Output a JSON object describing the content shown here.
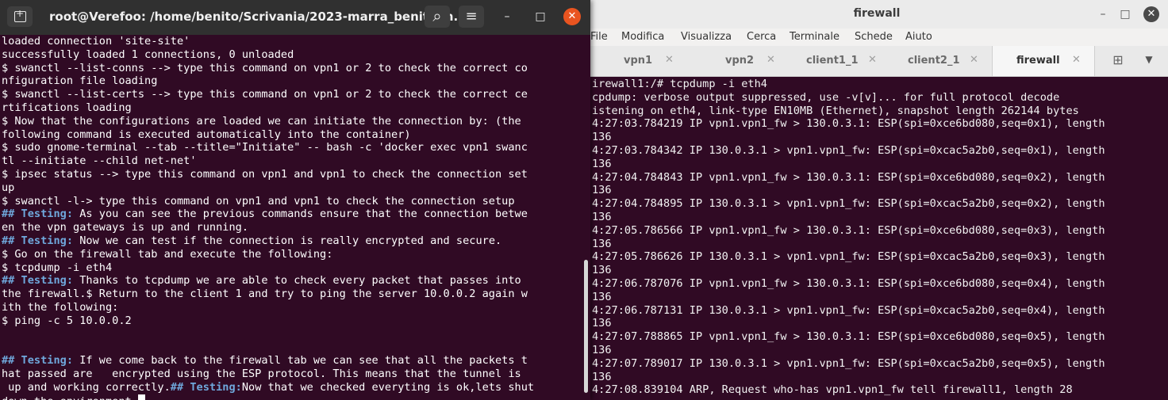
{
  "right_window": {
    "title": "firewall",
    "controls": {
      "minimize": "–",
      "maximize": "□",
      "close": "✕"
    },
    "menu": [
      "File",
      "Modifica",
      "Visualizza",
      "Cerca",
      "Terminale",
      "Schede",
      "Aiuto"
    ],
    "tabs": [
      {
        "label": "vpn1"
      },
      {
        "label": "vpn2"
      },
      {
        "label": "client1_1"
      },
      {
        "label": "client2_1"
      },
      {
        "label": "firewall"
      }
    ],
    "lines": [
      "irewall1:/# tcpdump -i eth4",
      "cpdump: verbose output suppressed, use -v[v]... for full protocol decode",
      "istening on eth4, link-type EN10MB (Ethernet), snapshot length 262144 bytes",
      "4:27:03.784219 IP vpn1.vpn1_fw > 130.0.3.1: ESP(spi=0xce6bd080,seq=0x1), length",
      "136",
      "4:27:03.784342 IP 130.0.3.1 > vpn1.vpn1_fw: ESP(spi=0xcac5a2b0,seq=0x1), length",
      "136",
      "4:27:04.784843 IP vpn1.vpn1_fw > 130.0.3.1: ESP(spi=0xce6bd080,seq=0x2), length",
      "136",
      "4:27:04.784895 IP 130.0.3.1 > vpn1.vpn1_fw: ESP(spi=0xcac5a2b0,seq=0x2), length",
      "136",
      "4:27:05.786566 IP vpn1.vpn1_fw > 130.0.3.1: ESP(spi=0xce6bd080,seq=0x3), length",
      "136",
      "4:27:05.786626 IP 130.0.3.1 > vpn1.vpn1_fw: ESP(spi=0xcac5a2b0,seq=0x3), length",
      "136",
      "4:27:06.787076 IP vpn1.vpn1_fw > 130.0.3.1: ESP(spi=0xce6bd080,seq=0x4), length",
      "136",
      "4:27:06.787131 IP 130.0.3.1 > vpn1.vpn1_fw: ESP(spi=0xcac5a2b0,seq=0x4), length",
      "136",
      "4:27:07.788865 IP vpn1.vpn1_fw > 130.0.3.1: ESP(spi=0xce6bd080,seq=0x5), length",
      "136",
      "4:27:07.789017 IP 130.0.3.1 > vpn1.vpn1_fw: ESP(spi=0xcac5a2b0,seq=0x5), length",
      "136",
      "4:27:08.839104 ARP, Request who-has vpn1.vpn1_fw tell firewall1, length 28"
    ]
  },
  "left_window": {
    "title": "root@Verefoo: /home/benito/Scrivania/2023-marra_benito/m...",
    "controls": {
      "search": "⌕",
      "menu": "≡",
      "minimize": "–",
      "maximize": "□",
      "close": "✕"
    },
    "lines": [
      {
        "text": "loaded connection 'site-site'"
      },
      {
        "text": "successfully loaded 1 connections, 0 unloaded"
      },
      {
        "text": "$ swanctl --list-conns --> type this command on vpn1 or 2 to check the correct co"
      },
      {
        "text": "nfiguration file loading"
      },
      {
        "text": "$ swanctl --list-certs --> type this command on vpn1 or 2 to check the correct ce"
      },
      {
        "text": "rtifications loading"
      },
      {
        "text": "$ Now that the configurations are loaded we can initiate the connection by: (the"
      },
      {
        "text": "following command is executed automatically into the container)"
      },
      {
        "text": "$ sudo gnome-terminal --tab --title=\"Initiate\" -- bash -c 'docker exec vpn1 swanc"
      },
      {
        "text": "tl --initiate --child net-net'"
      },
      {
        "text": "$ ipsec status --> type this command on vpn1 and vpn1 to check the connection set"
      },
      {
        "text": "up"
      },
      {
        "text": "$ swanctl -l-> type this command on vpn1 and vpn1 to check the connection setup"
      },
      {
        "tag": "## Testing:",
        "text": " As you can see the previous commands ensure that the connection betwe"
      },
      {
        "text": "en the vpn gateways is up and running."
      },
      {
        "tag": "## Testing:",
        "text": " Now we can test if the connection is really encrypted and secure."
      },
      {
        "text": "$ Go on the firewall tab and execute the following:"
      },
      {
        "text": "$ tcpdump -i eth4"
      },
      {
        "tag": "## Testing:",
        "text": " Thanks to tcpdump we are able to check every packet that passes into"
      },
      {
        "text": "the firewall.$ Return to the client 1 and try to ping the server 10.0.0.2 again w"
      },
      {
        "text": "ith the following:"
      },
      {
        "text": "$ ping -c 5 10.0.0.2"
      },
      {
        "text": ""
      },
      {
        "text": ""
      },
      {
        "tag": "## Testing:",
        "text": " If we come back to the firewall tab we can see that all the packets t"
      },
      {
        "text": "hat passed are   encrypted using the ESP protocol. This means that the tunnel is"
      },
      {
        "pre": " up and working correctly.",
        "tag": "## Testing:",
        "text": "Now that we checked everyting is ok,lets shut"
      },
      {
        "text": "down the environment.",
        "cursor": true
      }
    ]
  }
}
